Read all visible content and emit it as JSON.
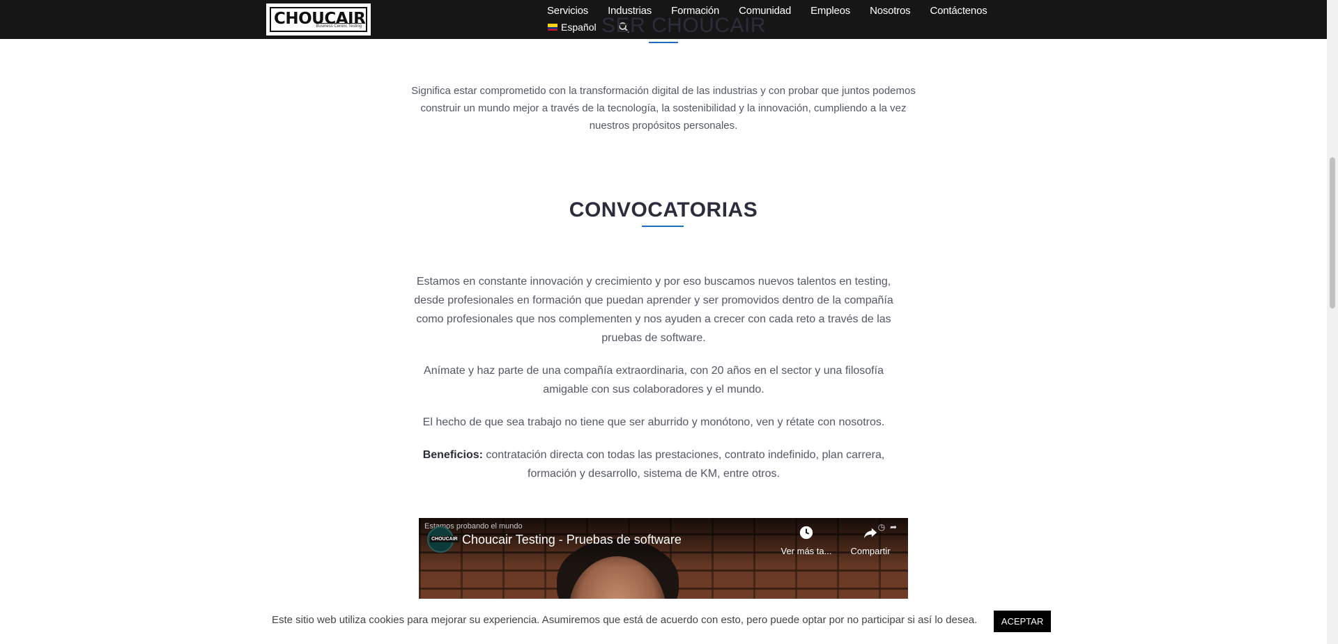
{
  "header": {
    "logo_text": "CHOUCAIR",
    "logo_tagline": "Business Centric Testing",
    "nav": [
      "Servicios",
      "Industrias",
      "Formación",
      "Comunidad",
      "Empleos",
      "Nosotros",
      "Contáctenos"
    ],
    "language": "Español"
  },
  "prev_section": {
    "title": "SER CHOUCAIR",
    "intro": "Significa estar comprometido con la transformación digital de las industrias y con probar que juntos podemos construir un mundo mejor a través de la tecnología, la sostenibilidad y la innovación, cumpliendo a la vez nuestros propósitos personales."
  },
  "convocatorias": {
    "title": "CONVOCATORIAS",
    "p1": "Estamos en constante innovación y crecimiento y por eso buscamos nuevos talentos en testing, desde profesionales en formación que puedan aprender y ser promovidos dentro de la compañía como profesionales que nos complementen y nos ayuden a crecer con cada reto a través de las pruebas de software.",
    "p2": "Anímate y haz parte de una compañía extraordinaria, con 20 años en el sector y una filosofía amigable con sus colaboradores y el mundo.",
    "p3": "El hecho de que sea trabajo no tiene que ser aburrido y monótono, ven y rétate con nosotros.",
    "benefits_label": "Beneficios:",
    "benefits_text": " contratación directa con todas las prestaciones, contrato indefinido,  plan carrera, formación y desarrollo, sistema de KM, entre otros."
  },
  "video": {
    "overline": "Estamos probando el mundo",
    "channel_badge": "CHOUCAIR",
    "title": "Choucair Testing - Pruebas de software",
    "watch_later": "Ver más ta...",
    "share": "Compartir"
  },
  "cookie": {
    "text": "Este sitio web utiliza cookies para mejorar su experiencia. Asumiremos que está de acuerdo con esto, pero puede optar por no participar si así lo desea.",
    "accept": "ACEPTAR"
  }
}
